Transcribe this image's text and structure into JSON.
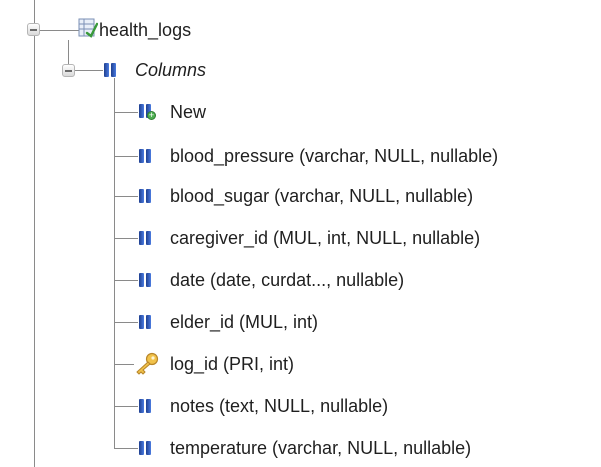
{
  "tree": {
    "table": {
      "label": "health_logs",
      "icon": "table-icon"
    },
    "group": {
      "label": "Columns",
      "icon": "columns-icon"
    },
    "items": [
      {
        "label": "New",
        "icon": "new-column-icon"
      },
      {
        "label": "blood_pressure (varchar, NULL, nullable)",
        "icon": "column-icon"
      },
      {
        "label": "blood_sugar (varchar, NULL, nullable)",
        "icon": "column-icon"
      },
      {
        "label": "caregiver_id (MUL, int, NULL, nullable)",
        "icon": "column-icon"
      },
      {
        "label": "date (date, curdat..., nullable)",
        "icon": "column-icon"
      },
      {
        "label": "elder_id (MUL, int)",
        "icon": "column-icon"
      },
      {
        "label": "log_id (PRI, int)",
        "icon": "primary-key-icon"
      },
      {
        "label": "notes (text, NULL, nullable)",
        "icon": "column-icon"
      },
      {
        "label": "temperature (varchar, NULL, nullable)",
        "icon": "column-icon"
      }
    ]
  },
  "colors": {
    "connector": "#8a8a8a",
    "column_icon": "#2f5fc4",
    "key_icon": "#e3b23c",
    "new_badge": "#4caf50"
  }
}
